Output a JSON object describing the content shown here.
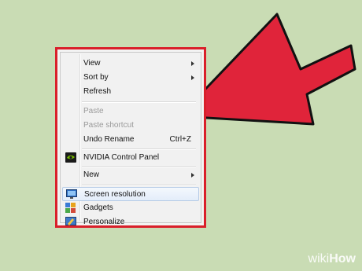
{
  "menu": {
    "items": [
      {
        "label": "View",
        "submenu": true
      },
      {
        "label": "Sort by",
        "submenu": true
      },
      {
        "label": "Refresh"
      },
      {
        "label": "Paste",
        "disabled": true
      },
      {
        "label": "Paste shortcut",
        "disabled": true
      },
      {
        "label": "Undo Rename",
        "shortcut": "Ctrl+Z"
      },
      {
        "label": "NVIDIA Control Panel",
        "icon": "nvidia-icon"
      },
      {
        "label": "New",
        "submenu": true
      },
      {
        "label": "Screen resolution",
        "icon": "screen-resolution-icon",
        "highlighted": true
      },
      {
        "label": "Gadgets",
        "icon": "gadgets-icon"
      },
      {
        "label": "Personalize",
        "icon": "personalize-icon"
      }
    ]
  },
  "watermark": {
    "wiki": "wiki",
    "how": "How"
  },
  "colors": {
    "highlight_border": "#d91f2a",
    "arrow": "#e0243a",
    "background": "#c9dcb4"
  }
}
